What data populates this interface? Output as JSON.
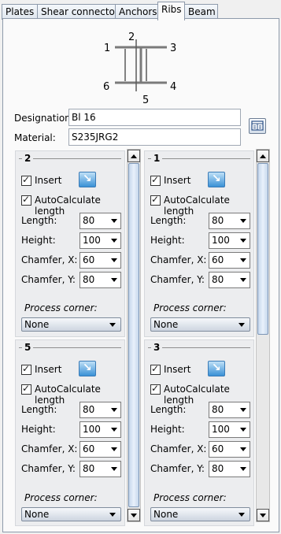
{
  "tabs": [
    {
      "label": "Plates",
      "active": false
    },
    {
      "label": "Shear connector",
      "active": false
    },
    {
      "label": "Anchors",
      "active": false
    },
    {
      "label": "Ribs",
      "active": true
    },
    {
      "label": "Beam",
      "active": false
    }
  ],
  "diagram": {
    "labels": [
      "1",
      "2",
      "3",
      "4",
      "5",
      "6"
    ]
  },
  "fields": {
    "designation_label": "Designation:",
    "designation_value": "Bl 16",
    "material_label": "Material:",
    "material_value": "S235JRG2"
  },
  "rib_groups": [
    {
      "title": "2",
      "insert_label": "Insert",
      "insert_checked": true,
      "auto_label": "AutoCalculate length",
      "auto_checked": true,
      "length_label": "Length:",
      "length": "80",
      "height_label": "Height:",
      "height": "100",
      "chamfer_x_label": "Chamfer, X:",
      "chamfer_x": "60",
      "chamfer_y_label": "Chamfer, Y:",
      "chamfer_y": "80",
      "process_corner_label": "Process corner:",
      "process_corner": "None"
    },
    {
      "title": "1",
      "insert_label": "Insert",
      "insert_checked": true,
      "auto_label": "AutoCalculate length",
      "auto_checked": true,
      "length_label": "Length:",
      "length": "80",
      "height_label": "Height:",
      "height": "100",
      "chamfer_x_label": "Chamfer, X:",
      "chamfer_x": "60",
      "chamfer_y_label": "Chamfer, Y:",
      "chamfer_y": "80",
      "process_corner_label": "Process corner:",
      "process_corner": "None"
    },
    {
      "title": "5",
      "insert_label": "Insert",
      "insert_checked": true,
      "auto_label": "AutoCalculate length",
      "auto_checked": true,
      "length_label": "Length:",
      "length": "80",
      "height_label": "Height:",
      "height": "100",
      "chamfer_x_label": "Chamfer, X:",
      "chamfer_x": "60",
      "chamfer_y_label": "Chamfer, Y:",
      "chamfer_y": "80",
      "process_corner_label": "Process corner:",
      "process_corner": "None"
    },
    {
      "title": "3",
      "insert_label": "Insert",
      "insert_checked": true,
      "auto_label": "AutoCalculate length",
      "auto_checked": true,
      "length_label": "Length:",
      "length": "80",
      "height_label": "Height:",
      "height": "100",
      "chamfer_x_label": "Chamfer, X:",
      "chamfer_x": "60",
      "chamfer_y_label": "Chamfer, Y:",
      "chamfer_y": "80",
      "process_corner_label": "Process corner:",
      "process_corner": "None"
    }
  ]
}
